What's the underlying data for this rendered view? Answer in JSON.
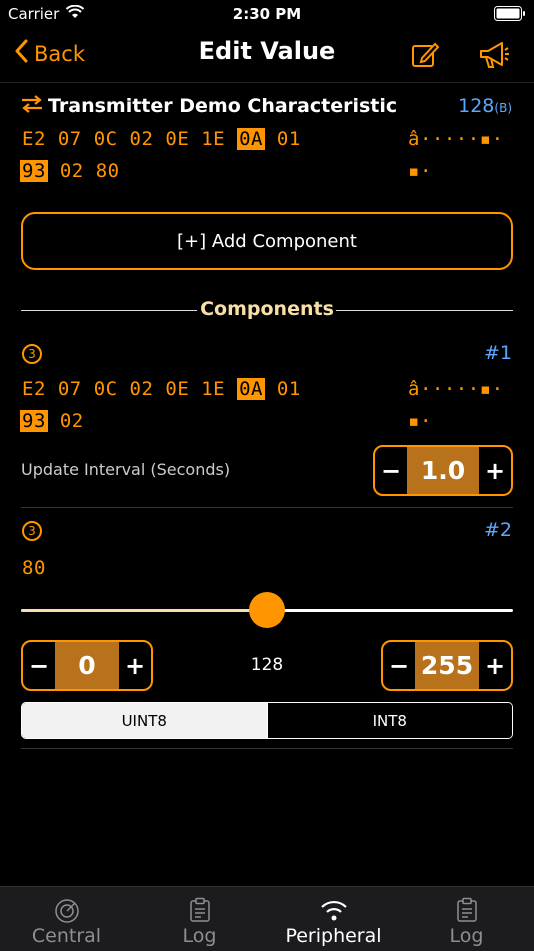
{
  "status": {
    "carrier": "Carrier",
    "time": "2:30 PM"
  },
  "nav": {
    "back_label": "Back",
    "title": "Edit Value"
  },
  "characteristic": {
    "name": "Transmitter Demo Characteristic",
    "size": "128",
    "size_unit": "B",
    "hex_row1": [
      "E2",
      "07",
      "0C",
      "02",
      "0E",
      "1E",
      "0A",
      "01"
    ],
    "hex_row2": [
      "93",
      "02",
      "80"
    ],
    "ascii_row1": "â·····▪·",
    "ascii_row2": "▪·"
  },
  "add_component_label": "[+] Add Component",
  "components_heading": "Components",
  "component1": {
    "badge": "3",
    "index": "#1",
    "hex_row1": [
      "E2",
      "07",
      "0C",
      "02",
      "0E",
      "1E",
      "0A",
      "01"
    ],
    "hex_row2": [
      "93",
      "02"
    ],
    "ascii_row1": "â·····▪·",
    "ascii_row2": "▪·",
    "label": "Update Interval (Seconds)",
    "value": "1.0"
  },
  "component2": {
    "badge": "3",
    "index": "#2",
    "hex_row1": [
      "80"
    ],
    "slider_fraction": 0.5,
    "min_value": "0",
    "mid_value": "128",
    "max_value": "255",
    "segments": [
      "UINT8",
      "INT8"
    ]
  },
  "tabs": [
    {
      "label": "Central",
      "icon": "radar-icon"
    },
    {
      "label": "Log",
      "icon": "clipboard-icon"
    },
    {
      "label": "Peripheral",
      "icon": "wifi-icon"
    },
    {
      "label": "Log",
      "icon": "clipboard-icon"
    }
  ],
  "colors": {
    "accent": "#ff9500",
    "blue": "#5aa9ff",
    "fill": "#b8721b"
  },
  "symbols": {
    "minus": "−",
    "plus": "+"
  }
}
